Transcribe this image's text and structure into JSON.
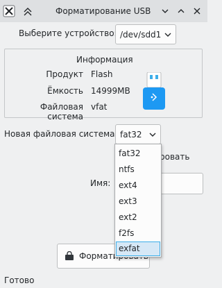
{
  "window": {
    "title": "Форматирование USB",
    "icons": [
      "app-icon",
      "pin-icon",
      "minimize-icon",
      "maximize-icon",
      "close-icon"
    ]
  },
  "device": {
    "label": "Выберите устройство:",
    "value": "/dev/sdd1"
  },
  "info": {
    "heading": "Информация",
    "rows": [
      {
        "label": "Продукт",
        "value": "Flash"
      },
      {
        "label": "Ёмкость",
        "value": "14999MB"
      },
      {
        "label": "Файловая система",
        "value": "vfat"
      }
    ],
    "icon": "usb-drive-icon"
  },
  "new_fs": {
    "label": "Новая файловая система:",
    "value": "fat32",
    "options": [
      "fat32",
      "ntfs",
      "ext4",
      "ext3",
      "ext2",
      "f2fs",
      "exfat"
    ],
    "highlighted": "exfat"
  },
  "check_partial": "ровать",
  "name": {
    "label": "Имя:",
    "value": ""
  },
  "format_button": {
    "label": "Форматировать",
    "icon": "lock-icon"
  },
  "status": "Готово",
  "colors": {
    "titlebar": "#dee0e2",
    "window_bg": "#eff0f1",
    "accent": "#3daee9",
    "selection_bg": "#d6e8f6",
    "usb_blue": "#1d99f3"
  }
}
